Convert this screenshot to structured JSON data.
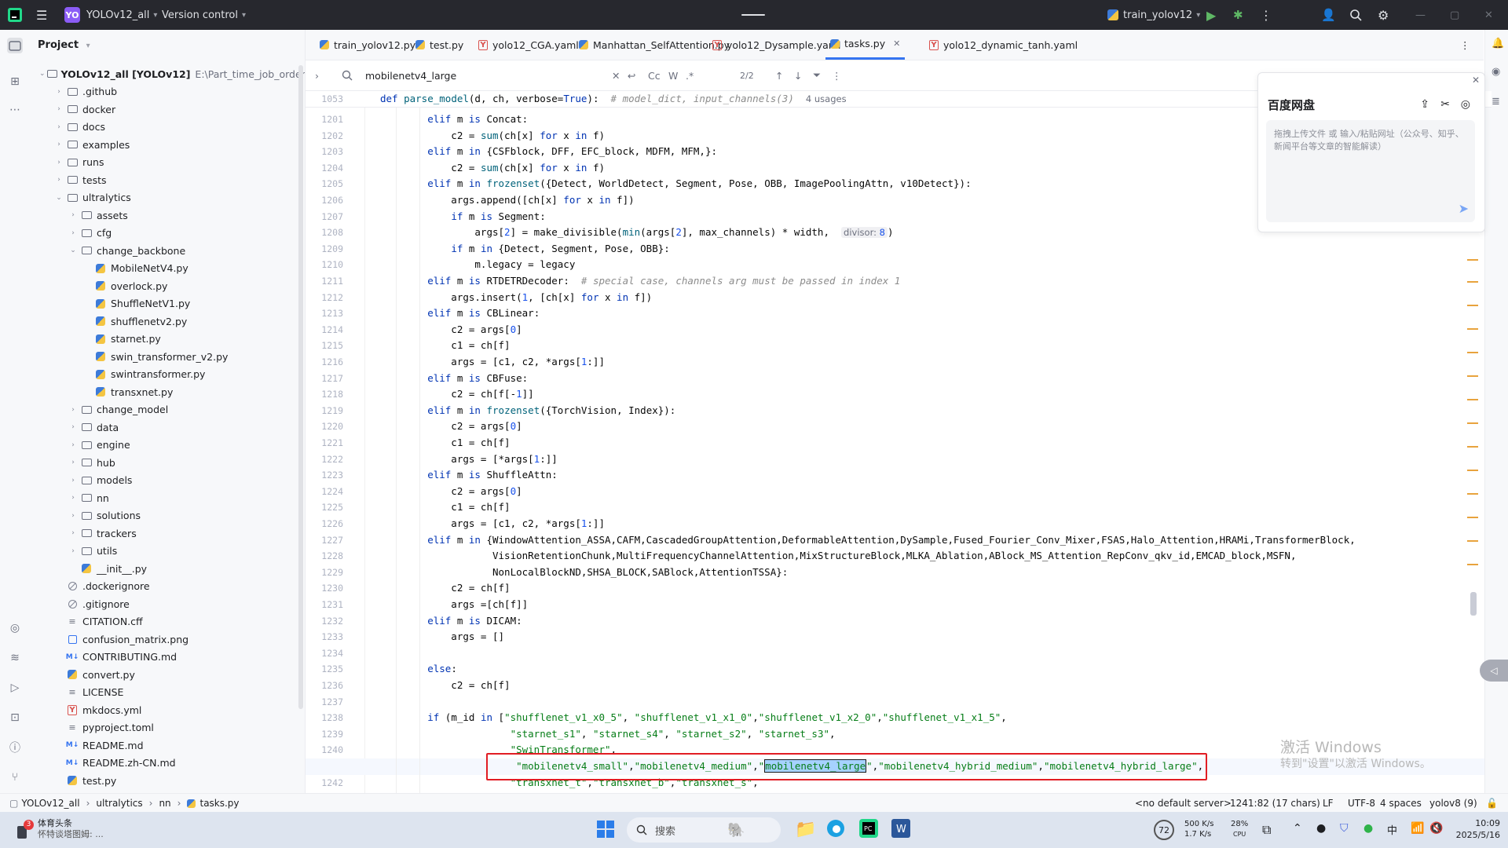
{
  "titlebar": {
    "project_badge": "YO",
    "project_name": "YOLOv12_all",
    "version_control": "Version control",
    "run_config": "train_yolov12"
  },
  "project_panel": {
    "header": "Project",
    "root_name": "YOLOv12_all [YOLOv12]",
    "root_path": "E:\\Part_time_job_orders\\YOLO",
    "items": [
      {
        "label": ".github",
        "type": "folder",
        "depth": 1,
        "expanded": false
      },
      {
        "label": "docker",
        "type": "folder",
        "depth": 1,
        "expanded": false
      },
      {
        "label": "docs",
        "type": "folder",
        "depth": 1,
        "expanded": false
      },
      {
        "label": "examples",
        "type": "folder",
        "depth": 1,
        "expanded": false
      },
      {
        "label": "runs",
        "type": "folder",
        "depth": 1,
        "expanded": false
      },
      {
        "label": "tests",
        "type": "folder",
        "depth": 1,
        "expanded": false
      },
      {
        "label": "ultralytics",
        "type": "folder",
        "depth": 1,
        "expanded": true
      },
      {
        "label": "assets",
        "type": "folder",
        "depth": 2,
        "expanded": false
      },
      {
        "label": "cfg",
        "type": "folder",
        "depth": 2,
        "expanded": false
      },
      {
        "label": "change_backbone",
        "type": "folder",
        "depth": 2,
        "expanded": true
      },
      {
        "label": "MobileNetV4.py",
        "type": "py",
        "depth": 3
      },
      {
        "label": "overlock.py",
        "type": "py",
        "depth": 3
      },
      {
        "label": "ShuffleNetV1.py",
        "type": "py",
        "depth": 3
      },
      {
        "label": "shufflenetv2.py",
        "type": "py",
        "depth": 3
      },
      {
        "label": "starnet.py",
        "type": "py",
        "depth": 3
      },
      {
        "label": "swin_transformer_v2.py",
        "type": "py",
        "depth": 3
      },
      {
        "label": "swintransformer.py",
        "type": "py",
        "depth": 3
      },
      {
        "label": "transxnet.py",
        "type": "py",
        "depth": 3
      },
      {
        "label": "change_model",
        "type": "folder",
        "depth": 2,
        "expanded": false
      },
      {
        "label": "data",
        "type": "folder",
        "depth": 2,
        "expanded": false
      },
      {
        "label": "engine",
        "type": "folder",
        "depth": 2,
        "expanded": false
      },
      {
        "label": "hub",
        "type": "folder",
        "depth": 2,
        "expanded": false
      },
      {
        "label": "models",
        "type": "folder",
        "depth": 2,
        "expanded": false
      },
      {
        "label": "nn",
        "type": "folder",
        "depth": 2,
        "expanded": false
      },
      {
        "label": "solutions",
        "type": "folder",
        "depth": 2,
        "expanded": false
      },
      {
        "label": "trackers",
        "type": "folder",
        "depth": 2,
        "expanded": false
      },
      {
        "label": "utils",
        "type": "folder",
        "depth": 2,
        "expanded": false
      },
      {
        "label": "__init__.py",
        "type": "py",
        "depth": 2
      },
      {
        "label": ".dockerignore",
        "type": "ignore",
        "depth": 1
      },
      {
        "label": ".gitignore",
        "type": "ignore",
        "depth": 1
      },
      {
        "label": "CITATION.cff",
        "type": "txt",
        "depth": 1
      },
      {
        "label": "confusion_matrix.png",
        "type": "img",
        "depth": 1
      },
      {
        "label": "CONTRIBUTING.md",
        "type": "md",
        "depth": 1
      },
      {
        "label": "convert.py",
        "type": "py",
        "depth": 1
      },
      {
        "label": "LICENSE",
        "type": "txt",
        "depth": 1
      },
      {
        "label": "mkdocs.yml",
        "type": "yaml",
        "depth": 1
      },
      {
        "label": "pyproject.toml",
        "type": "txt",
        "depth": 1
      },
      {
        "label": "README.md",
        "type": "md",
        "depth": 1
      },
      {
        "label": "README.zh-CN.md",
        "type": "md",
        "depth": 1
      },
      {
        "label": "test.py",
        "type": "py",
        "depth": 1
      }
    ]
  },
  "tabs": [
    {
      "label": "train_yolov12.py",
      "type": "py",
      "active": false
    },
    {
      "label": "test.py",
      "type": "py",
      "active": false
    },
    {
      "label": "yolo12_CGA.yaml",
      "type": "yaml",
      "active": false
    },
    {
      "label": "Manhattan_SelfAttention.py",
      "type": "py",
      "active": false
    },
    {
      "label": "yolo12_Dysample.yaml",
      "type": "yaml",
      "active": false
    },
    {
      "label": "tasks.py",
      "type": "py",
      "active": true
    },
    {
      "label": "yolo12_dynamic_tanh.yaml",
      "type": "yaml",
      "active": false
    }
  ],
  "findbar": {
    "query": "mobilenetv4_large",
    "match_case": "Cc",
    "words": "W",
    "regex": ".*",
    "count": "2/2"
  },
  "editor": {
    "sticky": {
      "line": "1053",
      "usages": "4 usages"
    },
    "lines": [
      {
        "n": "1201",
        "html": "        <span class=\"kw\">elif</span> m <span class=\"kw\">is</span> Concat:"
      },
      {
        "n": "1202",
        "html": "            c2 = <span class=\"fn\">sum</span>(ch[x] <span class=\"kw\">for</span> x <span class=\"kw\">in</span> f)"
      },
      {
        "n": "1203",
        "html": "        <span class=\"kw\">elif</span> m <span class=\"kw\">in</span> {CSFblock, DFF, EFC_block, MDFM, MFM,}:"
      },
      {
        "n": "1204",
        "html": "            c2 = <span class=\"fn\">sum</span>(ch[x] <span class=\"kw\">for</span> x <span class=\"kw\">in</span> f)"
      },
      {
        "n": "1205",
        "html": "        <span class=\"kw\">elif</span> m <span class=\"kw\">in</span> <span class=\"fn\">frozenset</span>({Detect, WorldDetect, Segment, Pose, OBB, ImagePoolingAttn, v10Detect}):"
      },
      {
        "n": "1206",
        "html": "            args.append([ch[x] <span class=\"kw\">for</span> x <span class=\"kw\">in</span> f])"
      },
      {
        "n": "1207",
        "html": "            <span class=\"kw\">if</span> m <span class=\"kw\">is</span> Segment:"
      },
      {
        "n": "1208",
        "html": "                args[<span class=\"num\">2</span>] = make_divisible(<span class=\"fn\">min</span>(args[<span class=\"num\">2</span>], max_channels) * width,  <span class=\"inl\">divisor: <span class=\"num\">8</span></span>)"
      },
      {
        "n": "1209",
        "html": "            <span class=\"kw\">if</span> m <span class=\"kw\">in</span> {Detect, Segment, Pose, OBB}:"
      },
      {
        "n": "1210",
        "html": "                m.legacy = legacy"
      },
      {
        "n": "1211",
        "html": "        <span class=\"kw\">elif</span> m <span class=\"kw\">is</span> RTDETRDecoder:  <span class=\"cm\"># special case, channels arg must be passed in index 1</span>"
      },
      {
        "n": "1212",
        "html": "            args.insert(<span class=\"num\">1</span>, [ch[x] <span class=\"kw\">for</span> x <span class=\"kw\">in</span> f])"
      },
      {
        "n": "1213",
        "html": "        <span class=\"kw\">elif</span> m <span class=\"kw\">is</span> CBLinear:"
      },
      {
        "n": "1214",
        "html": "            c2 = args[<span class=\"num\">0</span>]"
      },
      {
        "n": "1215",
        "html": "            c1 = ch[f]"
      },
      {
        "n": "1216",
        "html": "            args = [c1, c2, *args[<span class=\"num\">1</span>:]]"
      },
      {
        "n": "1217",
        "html": "        <span class=\"kw\">elif</span> m <span class=\"kw\">is</span> CBFuse:"
      },
      {
        "n": "1218",
        "html": "            c2 = ch[f[-<span class=\"num\">1</span>]]"
      },
      {
        "n": "1219",
        "html": "        <span class=\"kw\">elif</span> m <span class=\"kw\">in</span> <span class=\"fn\">frozenset</span>({TorchVision, Index}):"
      },
      {
        "n": "1220",
        "html": "            c2 = args[<span class=\"num\">0</span>]"
      },
      {
        "n": "1221",
        "html": "            c1 = ch[f]"
      },
      {
        "n": "1222",
        "html": "            args = [*args[<span class=\"num\">1</span>:]]"
      },
      {
        "n": "1223",
        "html": "        <span class=\"kw\">elif</span> m <span class=\"kw\">is</span> ShuffleAttn:"
      },
      {
        "n": "1224",
        "html": "            c2 = args[<span class=\"num\">0</span>]"
      },
      {
        "n": "1225",
        "html": "            c1 = ch[f]"
      },
      {
        "n": "1226",
        "html": "            args = [c1, c2, *args[<span class=\"num\">1</span>:]]"
      },
      {
        "n": "1227",
        "html": "        <span class=\"kw\">elif</span> m <span class=\"kw\">in</span> {WindowAttention_ASSA,CAFM,CascadedGroupAttention,DeformableAttention,DySample,Fused_Fourier_Conv_Mixer,FSAS,Halo_Attention,HRAMi,TransformerBlock,"
      },
      {
        "n": "1228",
        "html": "                   VisionRetentionChunk,MultiFrequencyChannelAttention,MixStructureBlock,MLKA_Ablation,ABlock_MS_Attention_RepConv_qkv_id,EMCAD_block,MSFN,"
      },
      {
        "n": "1229",
        "html": "                   NonLocalBlockND,SHSA_BLOCK,SABlock,AttentionTSSA}:"
      },
      {
        "n": "1230",
        "html": "            c2 = ch[f]"
      },
      {
        "n": "1231",
        "html": "            args =[ch[f]]"
      },
      {
        "n": "1232",
        "html": "        <span class=\"kw\">elif</span> m <span class=\"kw\">is</span> DICAM:"
      },
      {
        "n": "1233",
        "html": "            args = []"
      },
      {
        "n": "1234",
        "html": ""
      },
      {
        "n": "1235",
        "html": "        <span class=\"kw\">else</span>:"
      },
      {
        "n": "1236",
        "html": "            c2 = ch[f]"
      },
      {
        "n": "1237",
        "html": ""
      },
      {
        "n": "1238",
        "html": "        <span class=\"kw\">if</span> (m_id <span class=\"kw\">in</span> [<span class=\"str\">\"shufflenet_v1_x0_5\"</span>, <span class=\"str\">\"shufflenet_v1_x1_0\"</span>,<span class=\"str\">\"shufflenet_v1_x2_0\"</span>,<span class=\"str\">\"shufflenet_v1_x1_5\"</span>,"
      },
      {
        "n": "1239",
        "html": "                      <span class=\"str\">\"starnet_s1\"</span>, <span class=\"str\">\"starnet_s4\"</span>, <span class=\"str\">\"starnet_s2\"</span>, <span class=\"str\">\"starnet_s3\"</span>,"
      },
      {
        "n": "1240",
        "html": "                      <span class=\"str\">\"SwinTransformer\"</span>,"
      },
      {
        "n": "1241",
        "html": "                       <span class=\"str\">\"mobilenetv4_small\"</span>,<span class=\"str\">\"mobilenetv4_medium\"</span>,<span class=\"str\">\"<span class=\"sel\">mobilenetv4_large</span>\"</span>,<span class=\"str\">\"mobilenetv4_hybrid_medium\"</span>,<span class=\"str\">\"mobilenetv4_hybrid_large\"</span>,"
      },
      {
        "n": "1242",
        "html": "                      <span class=\"str\">\"transxnet_t\"</span>,<span class=\"str\">\"transxnet_b\"</span>,<span class=\"str\">\"transxnet_s\"</span>,"
      }
    ]
  },
  "baidu_panel": {
    "title": "百度网盘",
    "placeholder": "拖拽上传文件 或 输入/粘贴网址（公众号、知乎、新闻平台等文章的智能解读）"
  },
  "watermark": {
    "line1": "激活 Windows",
    "line2": "转到\"设置\"以激活 Windows。"
  },
  "breadcrumb": [
    "YOLOv12_all",
    "ultralytics",
    "nn",
    "tasks.py"
  ],
  "statusbar": {
    "server": "<no default server>",
    "position": "1241:82 (17 chars)",
    "line_sep": "LF",
    "encoding": "UTF-8",
    "indent": "4 spaces",
    "interpreter": "yolov8 (9)"
  },
  "taskbar": {
    "news_badge": "3",
    "news_title": "体育头条",
    "news_sub": "怀特谈塔图姆: ...",
    "search": "搜索",
    "temp": "72",
    "net_up": "500 K/s",
    "net_down": "1.7 K/s",
    "cpu": "28%",
    "cpu_label": "CPU",
    "ime": "中",
    "time": "10:09",
    "date": "2025/5/16"
  },
  "colors": {
    "accent": "#3574f0",
    "highlight_box": "#e11d24",
    "selection": "#a6d2ff"
  }
}
